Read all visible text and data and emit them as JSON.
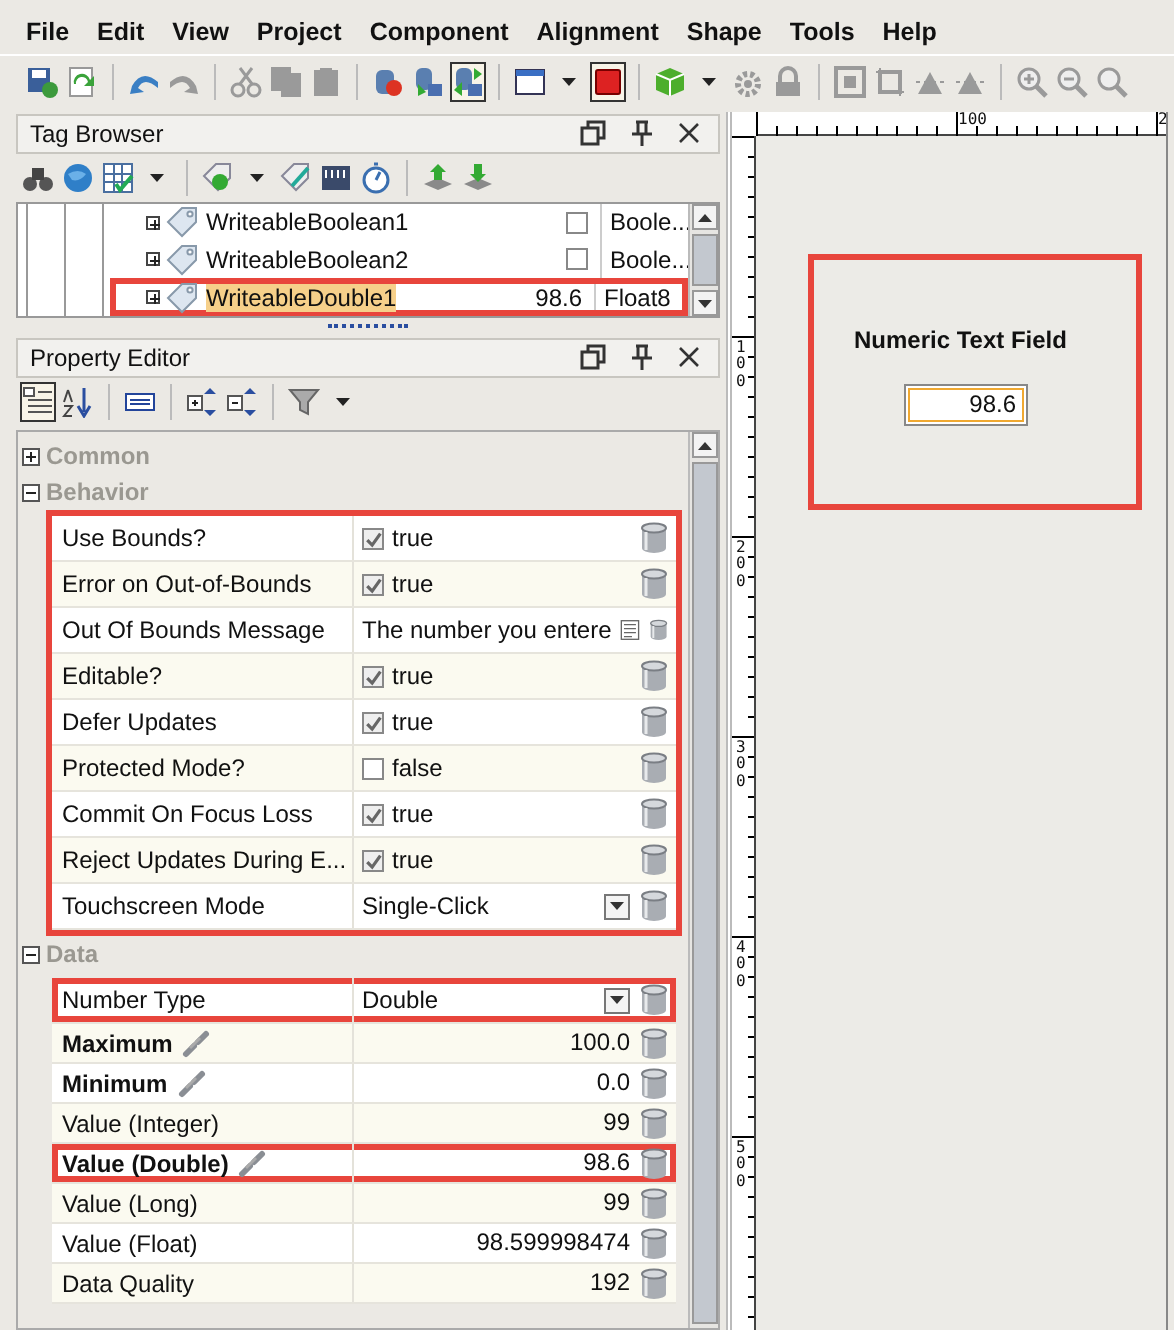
{
  "menu": [
    "File",
    "Edit",
    "View",
    "Project",
    "Component",
    "Alignment",
    "Shape",
    "Tools",
    "Help"
  ],
  "main_toolbar": [
    {
      "pressed": false,
      "disabled": false
    },
    {
      "pressed": false,
      "disabled": false
    },
    {
      "pressed": false,
      "disabled": false
    },
    {
      "pressed": false,
      "disabled": true
    },
    {
      "pressed": false,
      "disabled": true
    },
    {
      "pressed": false,
      "disabled": true
    },
    {
      "pressed": false,
      "disabled": true
    },
    {
      "pressed": false,
      "disabled": false
    },
    {
      "pressed": false,
      "disabled": false
    },
    {
      "pressed": true,
      "disabled": false
    },
    {
      "pressed": false,
      "disabled": false
    },
    {
      "pressed": true,
      "disabled": false
    },
    {
      "pressed": false,
      "disabled": false
    },
    {
      "pressed": false,
      "disabled": true
    },
    {
      "pressed": false,
      "disabled": true
    },
    {
      "pressed": false,
      "disabled": true
    },
    {
      "pressed": false,
      "disabled": true
    },
    {
      "pressed": false,
      "disabled": true
    },
    {
      "pressed": false,
      "disabled": true
    },
    {
      "pressed": false,
      "disabled": true
    },
    {
      "pressed": false,
      "disabled": true
    },
    {
      "pressed": false,
      "disabled": true
    }
  ],
  "tag_browser": {
    "title": "Tag Browser",
    "tags": [
      {
        "name": "WriteableBoolean1",
        "kind": "checkbox",
        "checked": false,
        "type": "Boole...",
        "selected": false,
        "highlighted": false
      },
      {
        "name": "WriteableBoolean2",
        "kind": "checkbox",
        "checked": false,
        "type": "Boole...",
        "selected": false,
        "highlighted": false
      },
      {
        "name": "WriteableDouble1",
        "kind": "text",
        "value": "98.6",
        "type": "Float8",
        "selected": true,
        "highlighted": true
      }
    ]
  },
  "property_editor": {
    "title": "Property Editor",
    "toolbar": [
      {
        "pressed": true
      },
      {
        "pressed": false
      },
      {
        "pressed": false
      },
      {
        "pressed": false
      },
      {
        "pressed": false
      },
      {
        "pressed": false
      }
    ],
    "groups": [
      {
        "name": "Common",
        "expanded": false
      },
      {
        "name": "Behavior",
        "expanded": true,
        "highlighted": true,
        "properties": [
          {
            "name": "Use Bounds?",
            "kind": "checkbox",
            "checked": true,
            "value": "true",
            "bold": false,
            "bound": false,
            "highlighted": false
          },
          {
            "name": "Error on Out-of-Bounds",
            "kind": "checkbox",
            "checked": true,
            "value": "true",
            "bold": false,
            "bound": false,
            "highlighted": false
          },
          {
            "name": "Out Of Bounds Message",
            "kind": "message",
            "value": "The number you entere",
            "bold": false,
            "bound": false,
            "highlighted": false
          },
          {
            "name": "Editable?",
            "kind": "checkbox",
            "checked": true,
            "value": "true",
            "bold": false,
            "bound": false,
            "highlighted": false
          },
          {
            "name": "Defer Updates",
            "kind": "checkbox",
            "checked": true,
            "value": "true",
            "bold": false,
            "bound": false,
            "highlighted": false
          },
          {
            "name": "Protected Mode?",
            "kind": "checkbox",
            "checked": false,
            "value": "false",
            "bold": false,
            "bound": false,
            "highlighted": false
          },
          {
            "name": "Commit On Focus Loss",
            "kind": "checkbox",
            "checked": true,
            "value": "true",
            "bold": false,
            "bound": false,
            "highlighted": false
          },
          {
            "name": "Reject Updates During E...",
            "kind": "checkbox",
            "checked": true,
            "value": "true",
            "bold": false,
            "bound": false,
            "highlighted": false
          },
          {
            "name": "Touchscreen Mode",
            "kind": "dropdown",
            "value": "Single-Click",
            "bold": false,
            "bound": false,
            "highlighted": false
          }
        ]
      },
      {
        "name": "Data",
        "expanded": true,
        "highlighted": false,
        "properties": [
          {
            "name": "Number Type",
            "kind": "dropdown",
            "value": "Double",
            "bold": false,
            "bound": false,
            "highlighted": true
          },
          {
            "name": "Maximum",
            "kind": "text",
            "value": "100.0",
            "bold": true,
            "bound": true,
            "highlighted": false
          },
          {
            "name": "Minimum",
            "kind": "text",
            "value": "0.0",
            "bold": true,
            "bound": true,
            "highlighted": false
          },
          {
            "name": "Value (Integer)",
            "kind": "text",
            "value": "99",
            "bold": false,
            "bound": false,
            "highlighted": false
          },
          {
            "name": "Value (Double)",
            "kind": "text",
            "value": "98.6",
            "bold": true,
            "bound": true,
            "highlighted": true
          },
          {
            "name": "Value (Long)",
            "kind": "text",
            "value": "99",
            "bold": false,
            "bound": false,
            "highlighted": false
          },
          {
            "name": "Value (Float)",
            "kind": "text",
            "value": "98.599998474",
            "bold": false,
            "bound": false,
            "highlighted": false
          },
          {
            "name": "Data Quality",
            "kind": "text",
            "value": "192",
            "bold": false,
            "bound": false,
            "highlighted": false
          }
        ]
      }
    ]
  },
  "designer": {
    "rulers": {
      "horizontal": [
        "100",
        "2"
      ],
      "vertical": [
        "100",
        "200",
        "300",
        "400",
        "500"
      ]
    },
    "component": {
      "label": "Numeric Text Field",
      "value": "98.6",
      "focused": true,
      "highlighted": true
    }
  }
}
